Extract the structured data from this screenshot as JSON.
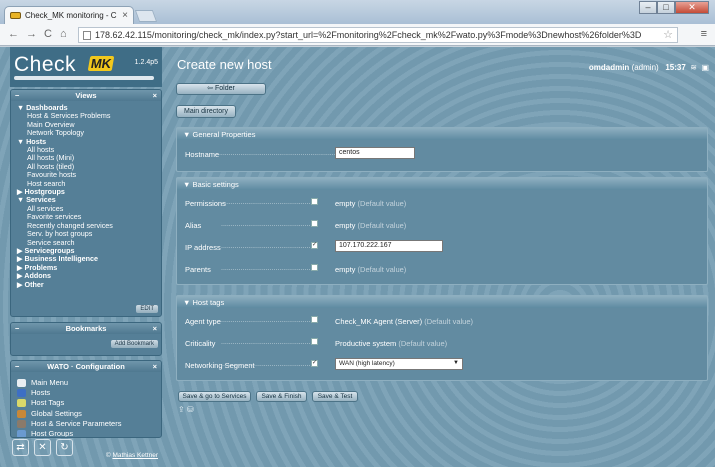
{
  "browser": {
    "tab_title": "Check_MK monitoring - C",
    "tab_close": "×",
    "url": "178.62.42.115/monitoring/check_mk/index.py?start_url=%2Fmonitoring%2Fcheck_mk%2Fwato.py%3Fmode%3Dnewhost%26folder%3D",
    "back": "←",
    "forward": "→",
    "reload": "C",
    "home": "⌂",
    "star": "☆",
    "menu": "≡",
    "win_min": "–",
    "win_max": "□",
    "win_close": "✕"
  },
  "sidebar": {
    "logo_text": "Check",
    "logo_mk": "MK",
    "version": "1.2.4p5",
    "views": {
      "title": "Views",
      "minimize": "−",
      "close": "×",
      "items": [
        {
          "label": "▼ Dashboards",
          "group": true
        },
        {
          "label": "Host & Services Problems",
          "group": false
        },
        {
          "label": "Main Overview",
          "group": false
        },
        {
          "label": "Network Topology",
          "group": false
        },
        {
          "label": "▼ Hosts",
          "group": true
        },
        {
          "label": "All hosts",
          "group": false
        },
        {
          "label": "All hosts (Mini)",
          "group": false
        },
        {
          "label": "All hosts (tiled)",
          "group": false
        },
        {
          "label": "Favourite hosts",
          "group": false
        },
        {
          "label": "Host search",
          "group": false
        },
        {
          "label": "▶ Hostgroups",
          "group": true
        },
        {
          "label": "▼ Services",
          "group": true
        },
        {
          "label": "All services",
          "group": false
        },
        {
          "label": "Favorite services",
          "group": false
        },
        {
          "label": "Recently changed services",
          "group": false
        },
        {
          "label": "Serv. by host groups",
          "group": false
        },
        {
          "label": "Service search",
          "group": false
        },
        {
          "label": "▶ Servicegroups",
          "group": true
        },
        {
          "label": "▶ Business Intelligence",
          "group": true
        },
        {
          "label": "▶ Problems",
          "group": true
        },
        {
          "label": "▶ Addons",
          "group": true
        },
        {
          "label": "▶ Other",
          "group": true
        }
      ],
      "edit_button": "EDIT"
    },
    "bookmarks": {
      "title": "Bookmarks",
      "minimize": "−",
      "close": "×",
      "add_button": "Add Bookmark"
    },
    "wato": {
      "title": "WATO · Configuration",
      "minimize": "−",
      "close": "×",
      "items": [
        {
          "label": "Main Menu",
          "color": "#e8eef2"
        },
        {
          "label": "Hosts",
          "color": "#3d6fc4"
        },
        {
          "label": "Host Tags",
          "color": "#d9d96a"
        },
        {
          "label": "Global Settings",
          "color": "#c88838"
        },
        {
          "label": "Host & Service Parameters",
          "color": "#8a7a6a"
        },
        {
          "label": "Host Groups",
          "color": "#6a9ad0"
        }
      ]
    },
    "footer": {
      "copyright_prefix": "© ",
      "copyright_name": "Mathias Kettner",
      "icons": [
        "⇄",
        "✕",
        "↻"
      ]
    }
  },
  "main": {
    "title": "Create new host",
    "user": "omdadmin",
    "role": "(admin)",
    "time": "15:37",
    "folder_button": "⇦  Folder",
    "main_directory_button": "Main directory",
    "general": {
      "title": "▼ General Properties",
      "hostname_label": "Hostname",
      "hostname_value": "centos"
    },
    "basic": {
      "title": "▼ Basic settings",
      "rows": [
        {
          "label": "Permissions",
          "checked": false,
          "value": "empty",
          "default": "(Default value)"
        },
        {
          "label": "Alias",
          "checked": false,
          "value": "empty",
          "default": "(Default value)"
        },
        {
          "label": "IP address",
          "checked": true,
          "input": "107.170.222.167"
        },
        {
          "label": "Parents",
          "checked": false,
          "value": "empty",
          "default": "(Default value)"
        }
      ]
    },
    "tags": {
      "title": "▼ Host tags",
      "rows": [
        {
          "label": "Agent type",
          "checked": false,
          "value": "Check_MK Agent (Server)",
          "default": "(Default value)"
        },
        {
          "label": "Criticality",
          "checked": false,
          "value": "Productive system",
          "default": "(Default value)"
        },
        {
          "label": "Networking Segment",
          "checked": true,
          "select": "WAN (high latency)"
        }
      ]
    },
    "actions": {
      "save_services": "Save & go to Services",
      "save_finish": "Save & Finish",
      "save_test": "Save & Test"
    },
    "dots": "...................................................................."
  },
  "colors": {
    "accent_mk": "#f2c81c",
    "panel_bg": "#628ba1",
    "sidebar_bg": "#557f97"
  }
}
